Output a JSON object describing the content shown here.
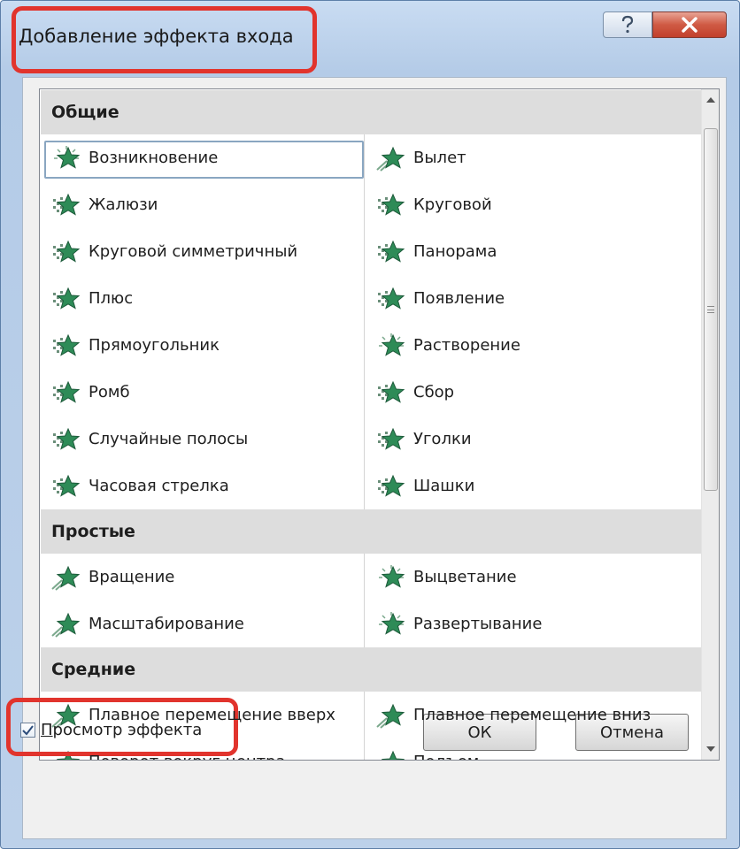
{
  "dialog": {
    "title": "Добавление эффекта входа",
    "help_glyph": "?",
    "close_glyph": "x"
  },
  "sections": [
    {
      "header": "Общие",
      "items": [
        {
          "label": "Возникновение",
          "icon": "appear-star-icon",
          "selected": true
        },
        {
          "label": "Вылет",
          "icon": "fly-in-star-icon"
        },
        {
          "label": "Жалюзи",
          "icon": "blinds-star-icon"
        },
        {
          "label": "Круговой",
          "icon": "wheel-star-icon"
        },
        {
          "label": "Круговой симметричный",
          "icon": "circle-star-icon"
        },
        {
          "label": "Панорама",
          "icon": "peek-star-icon"
        },
        {
          "label": "Плюс",
          "icon": "plus-star-icon"
        },
        {
          "label": "Появление",
          "icon": "wipe-star-icon"
        },
        {
          "label": "Прямоугольник",
          "icon": "box-star-icon"
        },
        {
          "label": "Растворение",
          "icon": "dissolve-star-icon"
        },
        {
          "label": "Ромб",
          "icon": "diamond-star-icon"
        },
        {
          "label": "Сбор",
          "icon": "split-star-icon"
        },
        {
          "label": "Случайные полосы",
          "icon": "random-bars-star-icon"
        },
        {
          "label": "Уголки",
          "icon": "corners-star-icon"
        },
        {
          "label": "Часовая стрелка",
          "icon": "clock-star-icon"
        },
        {
          "label": "Шашки",
          "icon": "checkerboard-star-icon"
        }
      ]
    },
    {
      "header": "Простые",
      "items": [
        {
          "label": "Вращение",
          "icon": "spin-star-icon"
        },
        {
          "label": "Выцветание",
          "icon": "fade-star-icon"
        },
        {
          "label": "Масштабирование",
          "icon": "zoom-star-icon"
        },
        {
          "label": "Развертывание",
          "icon": "expand-star-icon"
        }
      ]
    },
    {
      "header": "Средние",
      "items": [
        {
          "label": "Плавное перемещение вверх",
          "icon": "ascend-star-icon"
        },
        {
          "label": "Плавное перемещение вниз",
          "icon": "descend-star-icon"
        },
        {
          "label": "Поворот вокруг центра",
          "icon": "center-revolve-star-icon"
        },
        {
          "label": "Подъем",
          "icon": "rise-up-star-icon"
        }
      ]
    }
  ],
  "footer": {
    "preview_checked": true,
    "preview_label_underlined": "П",
    "preview_label_rest": "росмотр эффекта",
    "ok_label": "ОК",
    "cancel_label": "Отмена"
  },
  "colors": {
    "highlight_box": "#e1342d",
    "star_green": "#2e8b57",
    "header_bg": "#dddddd"
  }
}
